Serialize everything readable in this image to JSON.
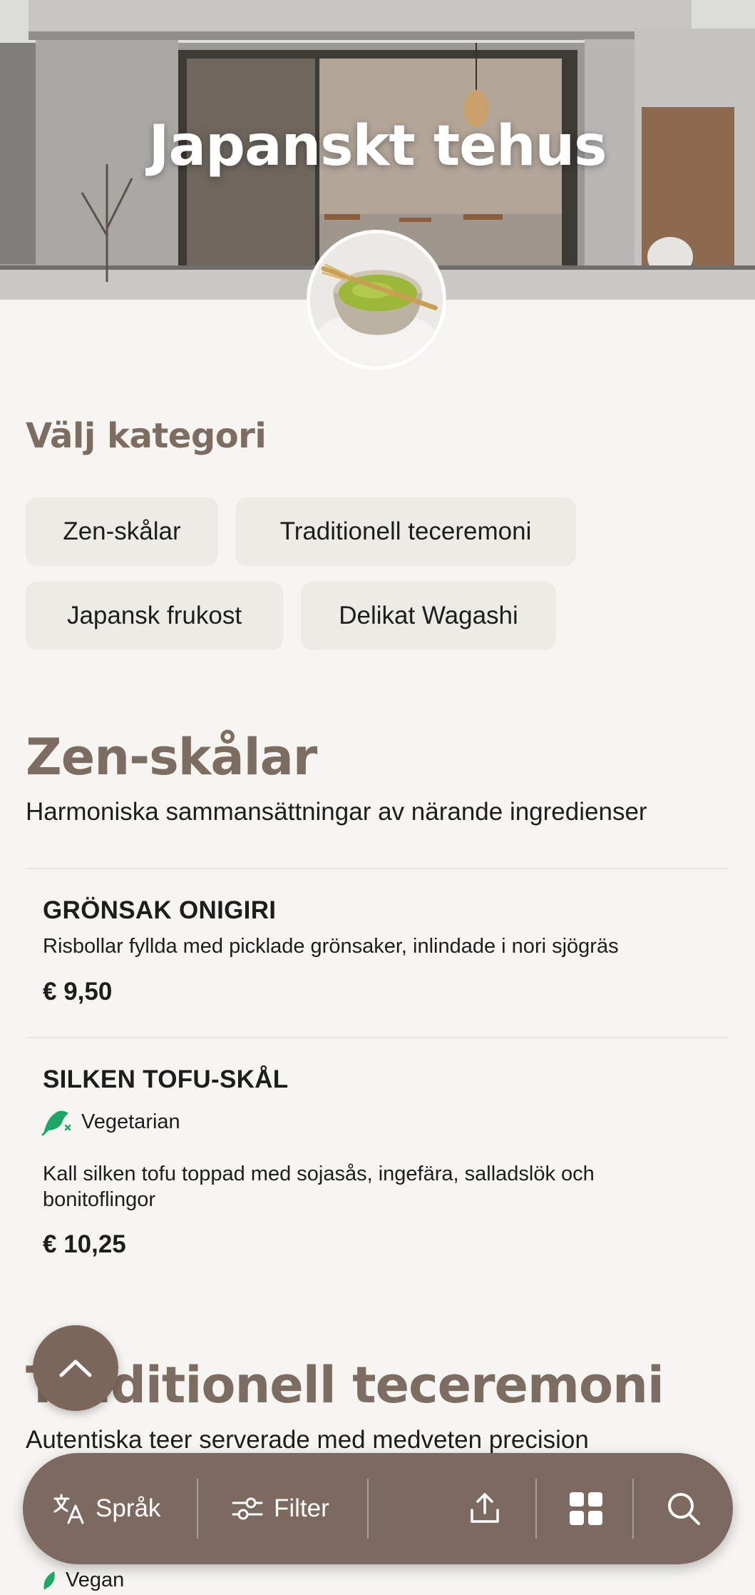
{
  "header": {
    "title": "Japanskt tehus"
  },
  "categories": {
    "heading": "Välj kategori",
    "items": [
      "Zen-skålar",
      "Traditionell teceremoni",
      "Japansk frukost",
      "Delikat Wagashi"
    ]
  },
  "sections": [
    {
      "title": "Zen-skålar",
      "subtitle": "Harmoniska sammansättningar av närande ingredienser",
      "items": [
        {
          "name": "GRÖNSAK ONIGIRI",
          "description": "Risbollar fyllda med picklade grönsaker, inlindade i nori sjögräs",
          "price": "€ 9,50"
        },
        {
          "name": "SILKEN TOFU-SKÅL",
          "tag": "Vegetarian",
          "description": "Kall silken tofu toppad med sojasås, ingefära, salladslök och bonitoflingor",
          "price": "€ 10,25"
        }
      ]
    },
    {
      "title": "Traditionell teceremoni",
      "subtitle": "Autentiska teer serverade med medveten precision",
      "items": [
        {
          "tag": "Vegan"
        }
      ]
    }
  ],
  "bottom_nav": {
    "language_label": "Språk",
    "filter_label": "Filter"
  },
  "icons": {
    "scroll_top": "chevron-up-icon",
    "language": "translate-icon",
    "filter": "sliders-icon",
    "share": "share-icon",
    "grid": "grid-icon",
    "search": "search-icon",
    "vegetarian": "leaf-icon",
    "vegan": "leaf-icon"
  },
  "colors": {
    "accent": "#7d6c62",
    "nav": "#7c695f",
    "background": "#f6f5f1",
    "chip": "#ecebe6",
    "leaf": "#1ea667"
  }
}
